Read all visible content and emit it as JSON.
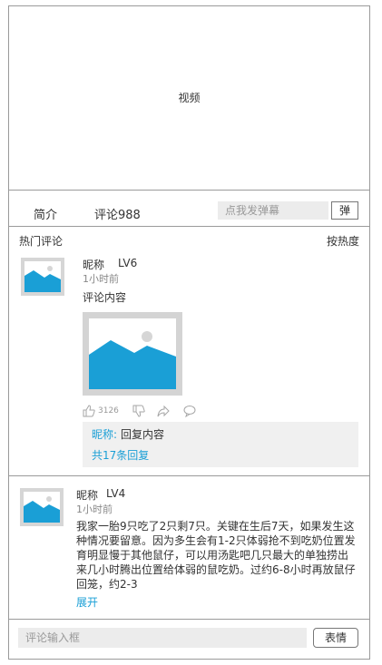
{
  "video": {
    "label": "视频"
  },
  "tabs": {
    "intro": "简介",
    "comments": "评论988"
  },
  "danmu": {
    "placeholder": "点我发弹幕",
    "send_label": "弹"
  },
  "hot": {
    "title": "热门评论",
    "sort": "按热度"
  },
  "comment1": {
    "nickname": "昵称",
    "level": "LV6",
    "time": "1小时前",
    "content": "评论内容",
    "likes": "3126",
    "reply": {
      "name": "昵称:",
      "text": "回复内容",
      "more": "共17条回复"
    }
  },
  "comment2": {
    "nickname": "昵称",
    "level": "LV4",
    "time": "1小时前",
    "content": "我家一胎9只吃了2只剩7只。关键在生后7天，如果发生这种情况要留意。因为多生会有1-2只体弱抢不到吃奶位置发育明显慢于其他鼠仔，可以用汤匙吧几只最大的单独捞出来几小时腾出位置给体弱的鼠吃奶。过约6-8小时再放鼠仔回笼，约2-3",
    "expand": "展开"
  },
  "bottom": {
    "placeholder": "评论输入框",
    "emoji_label": "表情"
  },
  "colors": {
    "accent": "#1a9fd6",
    "placeholder_bg": "#d6d6d6",
    "input_bg": "#ececec"
  },
  "icons": [
    "image-placeholder-icon",
    "thumbs-up-icon",
    "thumbs-down-icon",
    "share-icon",
    "comment-icon"
  ]
}
